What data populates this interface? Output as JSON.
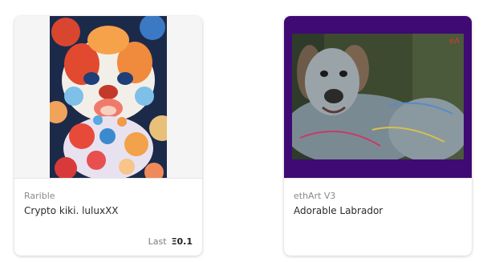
{
  "colors": {
    "card_background": "#ffffff",
    "card_media_background_1": "#f5f5f5",
    "card_media_background_2": "#3f0a73",
    "collection_text": "#8a8a8a",
    "title_text": "#2b2b2b"
  },
  "cards": [
    {
      "collection": "Rarible",
      "title": "Crypto kiki. luluxXX",
      "image": "colorful-painted-dog-artwork",
      "price": {
        "label": "Last",
        "value": "Ξ0.1"
      }
    },
    {
      "collection": "ethArt V3",
      "title": "Adorable Labrador",
      "image": "psychedelic-labrador-artwork"
    }
  ]
}
